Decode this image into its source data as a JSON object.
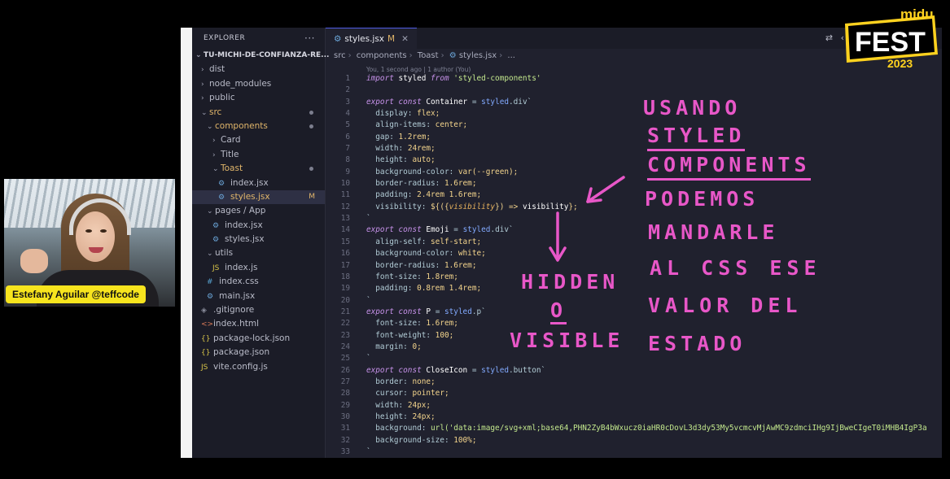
{
  "webcam": {
    "label": "Estefany Aguilar @teffcode"
  },
  "logo": {
    "line1": "midu",
    "line2": "FEST",
    "year": "2023"
  },
  "explorer": {
    "title": "EXPLORER",
    "more": "···",
    "root": "TU-MICHI-DE-CONFIANZA-RE...",
    "items": [
      {
        "label": "dist",
        "type": "folder",
        "depth": 1
      },
      {
        "label": "node_modules",
        "type": "folder",
        "depth": 1
      },
      {
        "label": "public",
        "type": "folder",
        "depth": 1
      },
      {
        "label": "src",
        "type": "folder-open",
        "depth": 1,
        "dot": true,
        "accent": true
      },
      {
        "label": "components",
        "type": "folder-open",
        "depth": 2,
        "dot": true,
        "accent": true
      },
      {
        "label": "Card",
        "type": "folder",
        "depth": 3
      },
      {
        "label": "Title",
        "type": "folder",
        "depth": 3
      },
      {
        "label": "Toast",
        "type": "folder-open",
        "depth": 3,
        "dot": true,
        "accent": true
      },
      {
        "label": "index.jsx",
        "type": "cog",
        "depth": 4
      },
      {
        "label": "styles.jsx",
        "type": "cog",
        "depth": 4,
        "badge": "M",
        "selected": true,
        "accent": true
      },
      {
        "label": "pages / App",
        "type": "folder-open",
        "depth": 2
      },
      {
        "label": "index.jsx",
        "type": "cog",
        "depth": 3
      },
      {
        "label": "styles.jsx",
        "type": "cog",
        "depth": 3
      },
      {
        "label": "utils",
        "type": "folder-open",
        "depth": 2
      },
      {
        "label": "index.js",
        "type": "js",
        "depth": 3
      },
      {
        "label": "index.css",
        "type": "css",
        "depth": 2
      },
      {
        "label": "main.jsx",
        "type": "cog",
        "depth": 2
      },
      {
        "label": ".gitignore",
        "type": "git",
        "depth": 1
      },
      {
        "label": "index.html",
        "type": "html",
        "depth": 1
      },
      {
        "label": "package-lock.json",
        "type": "json",
        "depth": 1
      },
      {
        "label": "package.json",
        "type": "json",
        "depth": 1
      },
      {
        "label": "vite.config.js",
        "type": "js",
        "depth": 1
      }
    ]
  },
  "tab": {
    "label": "styles.jsx",
    "modified": "M",
    "close": "✕"
  },
  "breadcrumb": [
    "src",
    "components",
    "Toast",
    "styles.jsx",
    "..."
  ],
  "blame": "You, 1 second ago | 1 author (You)",
  "code": [
    [
      [
        "kw",
        "import"
      ],
      [
        "id",
        " styled "
      ],
      [
        "kw",
        "from"
      ],
      [
        "str",
        " 'styled-components'"
      ]
    ],
    [],
    [
      [
        "kw",
        "export"
      ],
      [
        "kw",
        " const"
      ],
      [
        "id",
        " Container "
      ],
      [
        "prop",
        "= "
      ],
      [
        "fn",
        "styled"
      ],
      [
        "prop",
        ".div`"
      ]
    ],
    [
      [
        "prop",
        "  display: "
      ],
      [
        "val",
        "flex;"
      ]
    ],
    [
      [
        "prop",
        "  align-items: "
      ],
      [
        "val",
        "center;"
      ]
    ],
    [
      [
        "prop",
        "  gap: "
      ],
      [
        "val",
        "1.2rem;"
      ]
    ],
    [
      [
        "prop",
        "  width: "
      ],
      [
        "val",
        "24rem;"
      ]
    ],
    [
      [
        "prop",
        "  height: "
      ],
      [
        "val",
        "auto;"
      ]
    ],
    [
      [
        "prop",
        "  background-color: "
      ],
      [
        "val",
        "var(--green);"
      ]
    ],
    [
      [
        "prop",
        "  border-radius: "
      ],
      [
        "val",
        "1.6rem;"
      ]
    ],
    [
      [
        "prop",
        "  padding: "
      ],
      [
        "val",
        "2.4rem 1.6rem;"
      ]
    ],
    [
      [
        "prop",
        "  visibility: "
      ],
      [
        "val",
        "${({"
      ],
      [
        "var",
        "visibility"
      ],
      [
        "val",
        "}) => "
      ],
      [
        "id",
        "visibility"
      ],
      [
        "val",
        "};"
      ]
    ],
    [
      [
        "prop",
        "`"
      ]
    ],
    [
      [
        "kw",
        "export"
      ],
      [
        "kw",
        " const"
      ],
      [
        "id",
        " Emoji "
      ],
      [
        "prop",
        "= "
      ],
      [
        "fn",
        "styled"
      ],
      [
        "prop",
        ".div`"
      ]
    ],
    [
      [
        "prop",
        "  align-self: "
      ],
      [
        "val",
        "self-start;"
      ]
    ],
    [
      [
        "prop",
        "  background-color: "
      ],
      [
        "val",
        "white;"
      ]
    ],
    [
      [
        "prop",
        "  border-radius: "
      ],
      [
        "val",
        "1.6rem;"
      ]
    ],
    [
      [
        "prop",
        "  font-size: "
      ],
      [
        "val",
        "1.8rem;"
      ]
    ],
    [
      [
        "prop",
        "  padding: "
      ],
      [
        "val",
        "0.8rem 1.4rem;"
      ]
    ],
    [
      [
        "prop",
        "`"
      ]
    ],
    [
      [
        "kw",
        "export"
      ],
      [
        "kw",
        " const"
      ],
      [
        "id",
        " P "
      ],
      [
        "prop",
        "= "
      ],
      [
        "fn",
        "styled"
      ],
      [
        "prop",
        ".p`"
      ]
    ],
    [
      [
        "prop",
        "  font-size: "
      ],
      [
        "val",
        "1.6rem;"
      ]
    ],
    [
      [
        "prop",
        "  font-weight: "
      ],
      [
        "val",
        "100;"
      ]
    ],
    [
      [
        "prop",
        "  margin: "
      ],
      [
        "val",
        "0;"
      ]
    ],
    [
      [
        "prop",
        "`"
      ]
    ],
    [
      [
        "kw",
        "export"
      ],
      [
        "kw",
        " const"
      ],
      [
        "id",
        " CloseIcon "
      ],
      [
        "prop",
        "= "
      ],
      [
        "fn",
        "styled"
      ],
      [
        "prop",
        ".button`"
      ]
    ],
    [
      [
        "prop",
        "  border: "
      ],
      [
        "val",
        "none;"
      ]
    ],
    [
      [
        "prop",
        "  cursor: "
      ],
      [
        "val",
        "pointer;"
      ]
    ],
    [
      [
        "prop",
        "  width: "
      ],
      [
        "val",
        "24px;"
      ]
    ],
    [
      [
        "prop",
        "  height: "
      ],
      [
        "val",
        "24px;"
      ]
    ],
    [
      [
        "prop",
        "  background: "
      ],
      [
        "str",
        "url('data:image/svg+xml;base64,PHN2ZyB4bWxucz0iaHR0cDovL3d3dy53My5vcmcvMjAwMC9zdmciIHg9IjBweCIgeT0iMHB4IgP3a"
      ]
    ],
    [
      [
        "prop",
        "  background-size: "
      ],
      [
        "val",
        "100%;"
      ]
    ],
    [
      [
        "prop",
        "`"
      ]
    ]
  ],
  "annotations": {
    "notes": [
      "USANDO",
      "STYLED",
      "COMPONENTS",
      "PODEMOS",
      "MANDARLE",
      "AL CSS ESE",
      "VALOR DEL",
      "ESTADO"
    ],
    "hidden": "HIDDEN",
    "o": "O",
    "visible": "VISIBLE",
    "color": "#e857c8"
  },
  "colors": {
    "editor_bg": "#20212e",
    "sidebar_bg": "#1b1c27",
    "highlight": "#e857c8",
    "label_bg": "#f7e41e"
  }
}
